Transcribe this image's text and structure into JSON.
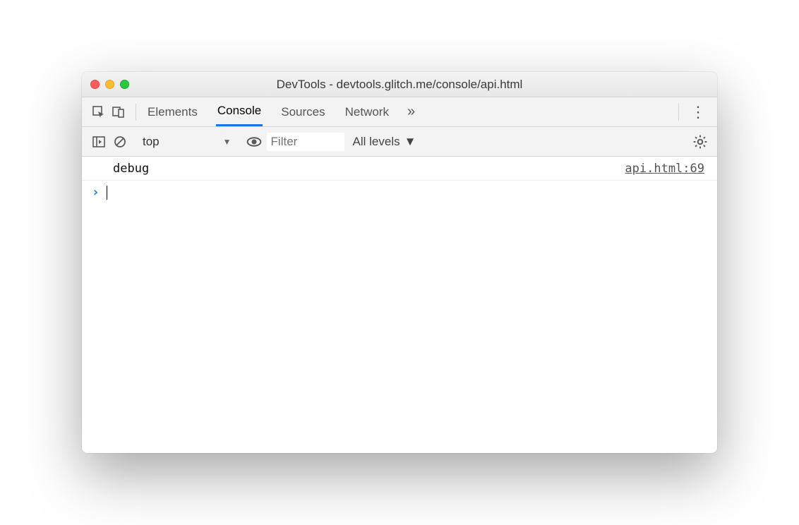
{
  "window": {
    "title": "DevTools - devtools.glitch.me/console/api.html"
  },
  "tabs": {
    "items": [
      "Elements",
      "Console",
      "Sources",
      "Network"
    ],
    "active_index": 1
  },
  "toolbar": {
    "context": "top",
    "filter_placeholder": "Filter",
    "levels_label": "All levels"
  },
  "console": {
    "log_text": "debug",
    "source_link": "api.html:69",
    "prompt": ">"
  }
}
